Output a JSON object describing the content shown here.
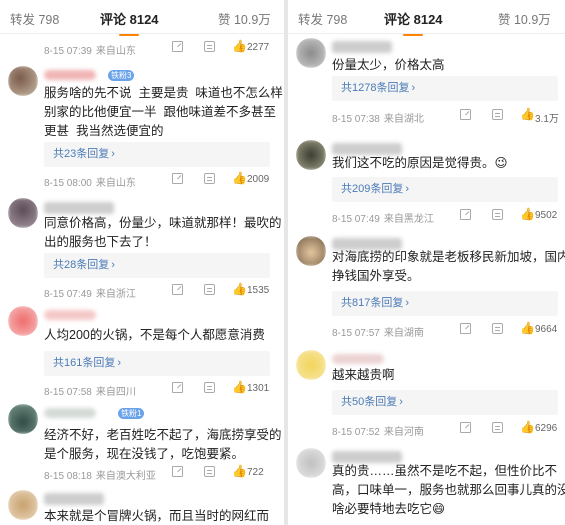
{
  "tabs": {
    "repost": "转发 798",
    "comments": "评论 8124",
    "likes": "赞 10.9万"
  },
  "colors": {
    "accent": "#ff8200",
    "link": "#4b7bb6",
    "badge": "#6aa3ea"
  },
  "icons": [
    "share-icon",
    "comment-icon",
    "thumb-up-icon",
    "chevron-right-icon"
  ],
  "left": {
    "top_meta": {
      "time": "8-15 07:39",
      "loc": "来自山东",
      "likes": "2277"
    },
    "comments": [
      {
        "badge": "铁粉3",
        "text": "服务啥的先不说  主要是贵  味道也不怎么样\n别家的比他便宜一半  跟他味道差不多甚至\n更甚  我当然选便宜的",
        "replies": "共23条回复",
        "time": "8-15 08:00",
        "loc": "来自山东",
        "likes": "2009"
      },
      {
        "text": "同意价格高，份量少，味道就那样！最吹的\n出的服务也下去了！",
        "replies": "共28条回复",
        "time": "8-15 07:49",
        "loc": "来自浙江",
        "likes": "1535"
      },
      {
        "text": "人均200的火锅，不是每个人都愿意消费",
        "replies": "共161条回复",
        "time": "8-15 07:58",
        "loc": "来自四川",
        "likes": "1301"
      },
      {
        "badge": "铁粉1",
        "text": "经济不好，老百姓吃不起了，海底捞享受的\n是个服务，现在没钱了，吃饱要紧。",
        "time": "8-15 08:18",
        "loc": "来自澳大利亚",
        "likes": "722"
      },
      {
        "text": "本来就是个冒牌火锅，而且当时的网红而"
      }
    ]
  },
  "right": {
    "comments": [
      {
        "text": "份量太少，价格太高",
        "replies": "共1278条回复",
        "time": "8-15 07:38",
        "loc": "来自湖北",
        "likes": "3.1万"
      },
      {
        "text": "我们这不吃的原因是觉得贵。😉",
        "replies": "共209条回复",
        "time": "8-15 07:49",
        "loc": "来自黑龙江",
        "likes": "9502"
      },
      {
        "text": "对海底捞的印象就是老板移民新加坡，国内\n挣钱国外享受。",
        "replies": "共817条回复",
        "time": "8-15 07:57",
        "loc": "来自湖南",
        "likes": "9664"
      },
      {
        "text": "越来越贵啊",
        "replies": "共50条回复",
        "time": "8-15 07:52",
        "loc": "来自河南",
        "likes": "6296"
      },
      {
        "text": "真的贵……虽然不是吃不起，但性价比不\n高，口味单一，服务也就那么回事儿真的没\n啥必要特地去吃它😄"
      }
    ]
  }
}
